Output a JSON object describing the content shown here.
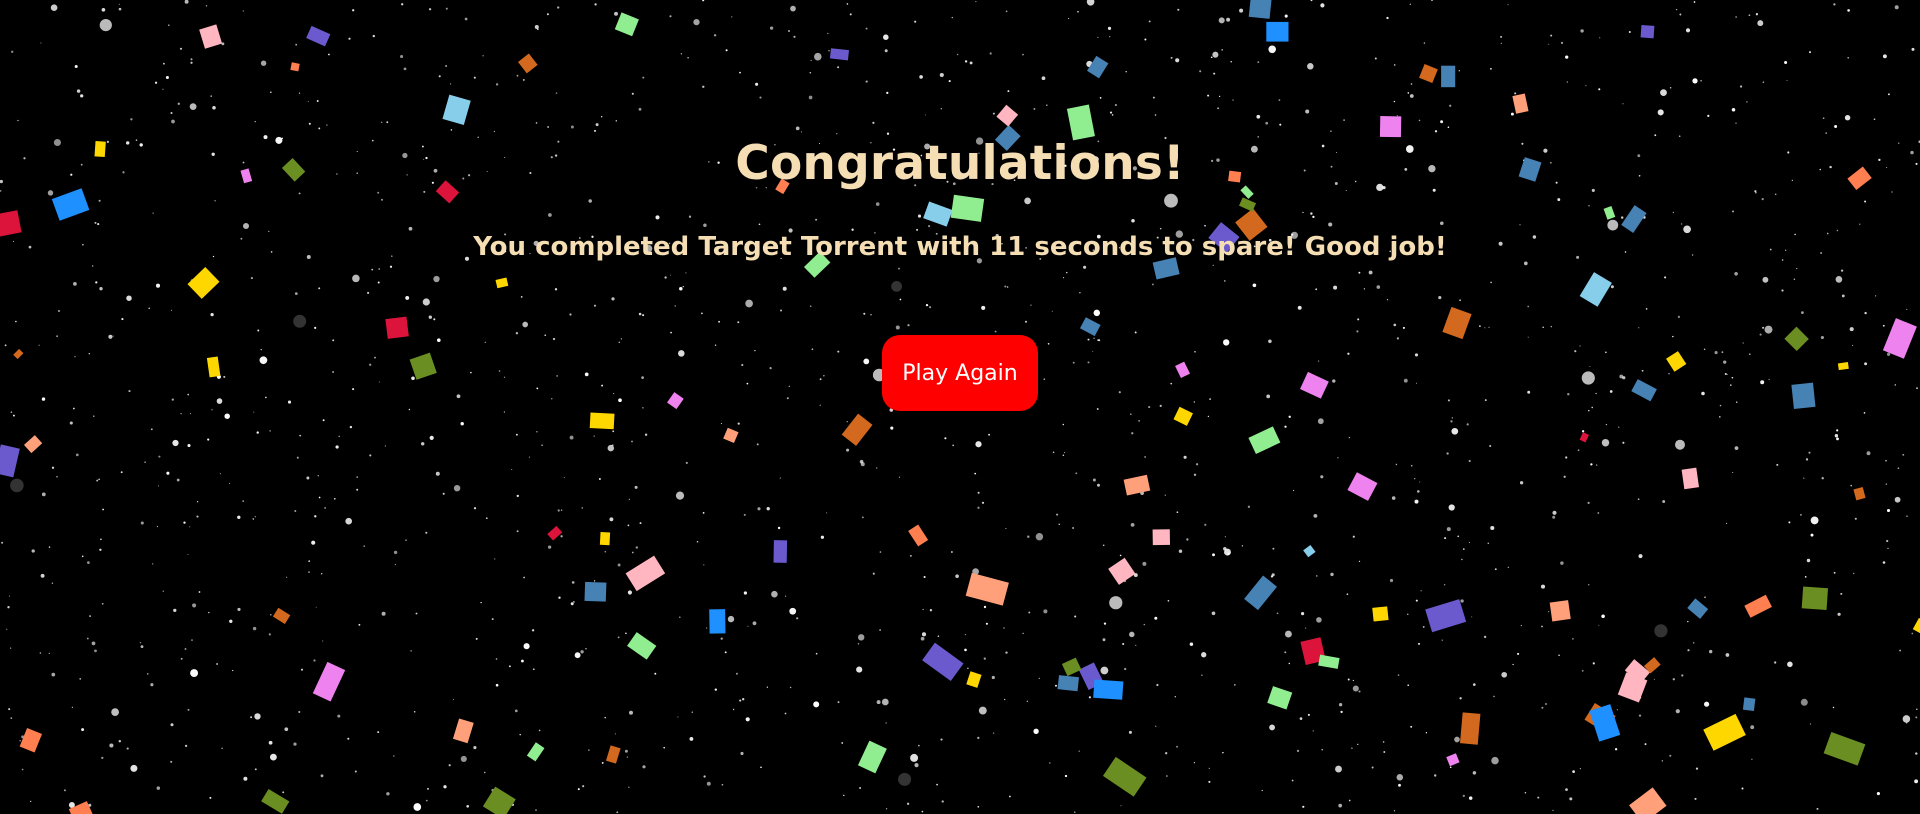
{
  "screen": {
    "title": "Congratulations!",
    "message": "You completed Target Torrent with 11 seconds to spare! Good job!",
    "play_again_label": "Play Again"
  },
  "colors": {
    "background": "#000000",
    "text": "#f5deb3",
    "button": "#ff0000",
    "button_text": "#ffffff",
    "confetti": [
      "#dc143c",
      "#ffa07a",
      "#ff7f50",
      "#6a5acd",
      "#1e90ff",
      "#90ee90",
      "#ee82ee",
      "#ffb6c1",
      "#87ceeb",
      "#6b8e23",
      "#4682b4",
      "#ffd700",
      "#d2691e"
    ]
  }
}
